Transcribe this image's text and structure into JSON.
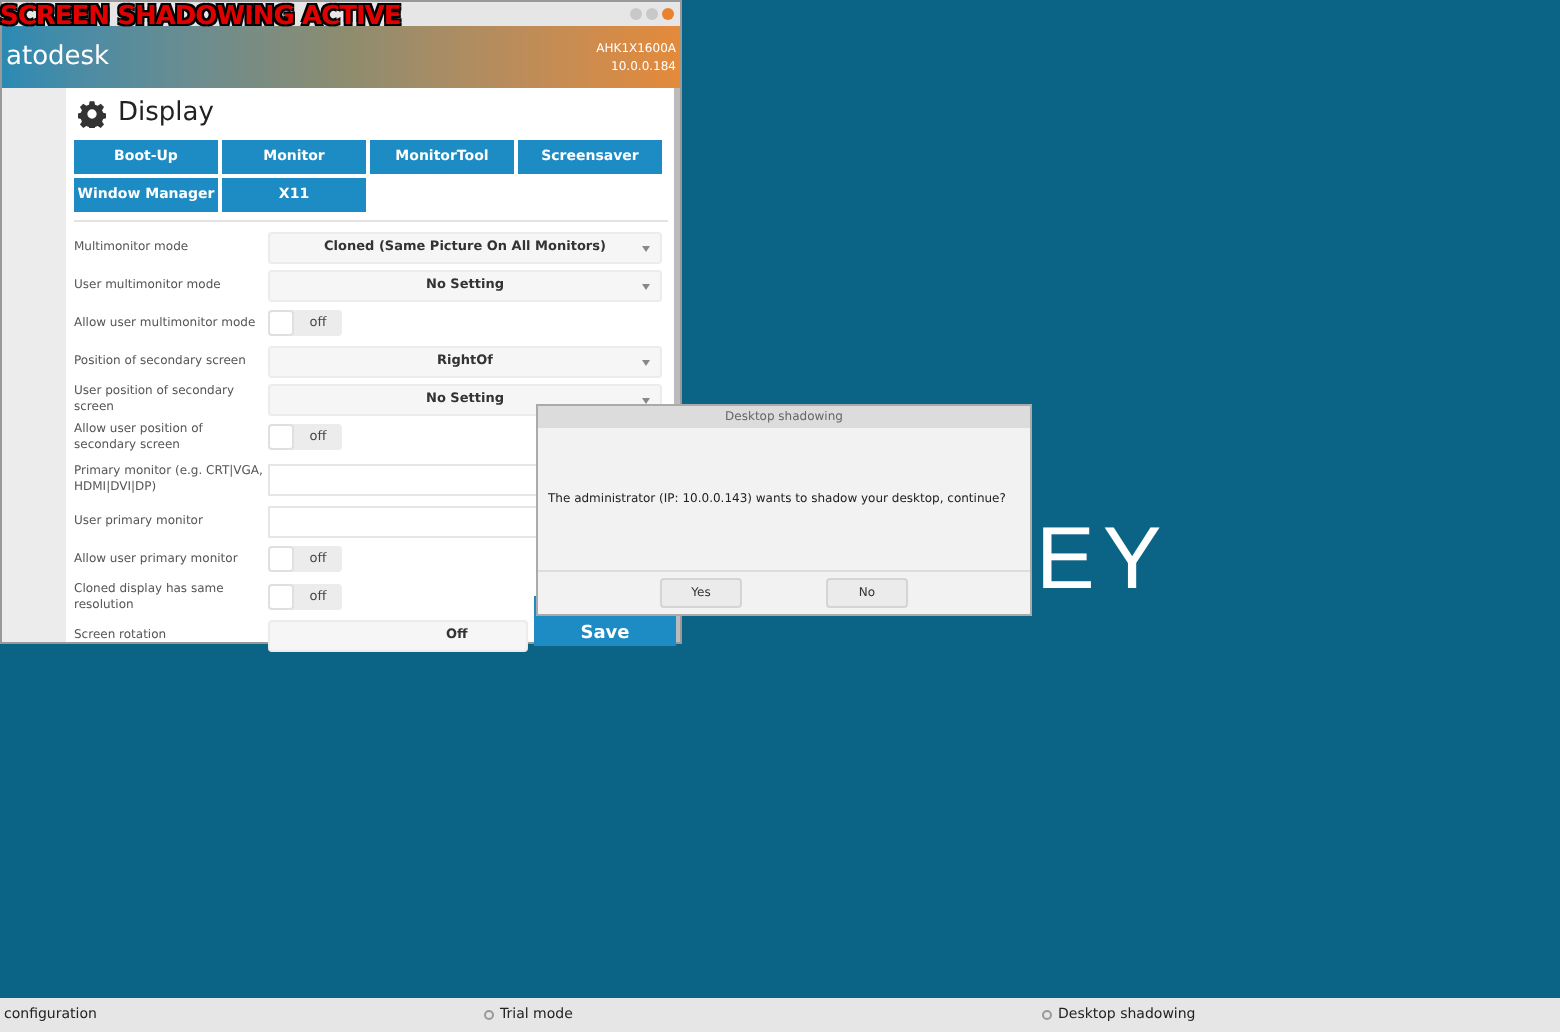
{
  "overlay_banner": "SCREEN SHADOWING ACTIVE",
  "window": {
    "brand": "atodesk",
    "host": "AHK1X1600A",
    "ip": "10.0.0.184"
  },
  "page_title": "Display",
  "tabs": [
    {
      "label": "Boot-Up",
      "selected": false
    },
    {
      "label": "Monitor",
      "selected": false
    },
    {
      "label": "MonitorTool",
      "selected": false
    },
    {
      "label": "Screensaver",
      "selected": false
    },
    {
      "label": "Window Manager",
      "selected": false
    },
    {
      "label": "X11",
      "selected": false
    }
  ],
  "settings": [
    {
      "kind": "select",
      "label": "Multimonitor mode",
      "value": "Cloned (Same Picture On All Monitors)"
    },
    {
      "kind": "select",
      "label": "User multimonitor mode",
      "value": "No Setting"
    },
    {
      "kind": "toggle",
      "label": "Allow user multimonitor mode",
      "state": "off",
      "on": false
    },
    {
      "kind": "select",
      "label": "Position of secondary screen",
      "value": "RightOf"
    },
    {
      "kind": "select",
      "label": "User position of secondary screen",
      "value": "No Setting"
    },
    {
      "kind": "toggle",
      "label": "Allow user position of secondary screen",
      "state": "off",
      "on": false
    },
    {
      "kind": "text",
      "label": "Primary monitor (e.g. CRT|VGA, HDMI|DVI|DP)"
    },
    {
      "kind": "text",
      "label": "User primary monitor"
    },
    {
      "kind": "toggle",
      "label": "Allow user primary monitor",
      "state": "off",
      "on": false
    },
    {
      "kind": "toggle",
      "label": "Cloned display has same resolution",
      "state": "off",
      "on": false
    },
    {
      "kind": "plain",
      "label": "Screen rotation",
      "value": "Off"
    }
  ],
  "save_button": "Save",
  "dialog": {
    "title": "Desktop shadowing",
    "message": "The administrator  (IP: 10.0.0.143) wants to shadow your desktop, continue?",
    "buttons": [
      "Yes",
      "No"
    ]
  },
  "desktop_text": "EY",
  "status_bar": [
    {
      "text": "configuration",
      "indicator": false
    },
    {
      "text": "Trial mode",
      "indicator": true
    },
    {
      "text": "Desktop shadowing",
      "indicator": true
    }
  ]
}
